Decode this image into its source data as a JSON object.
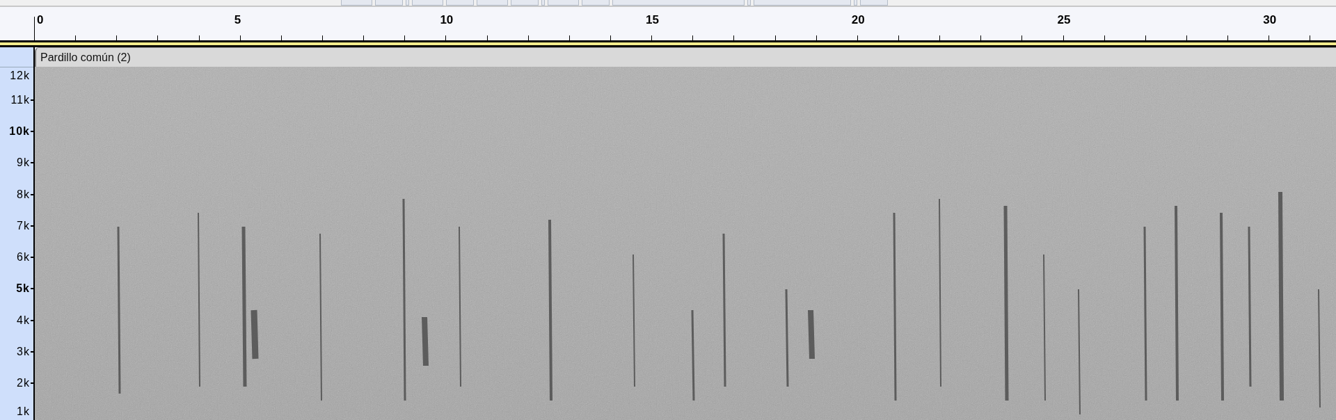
{
  "timeline": {
    "labels": [
      "0",
      "5",
      "10",
      "15",
      "20",
      "25",
      "30"
    ]
  },
  "track": {
    "label": "Pardillo común (2)"
  },
  "frequency_axis": {
    "labels": [
      {
        "text": "12k",
        "bold": false
      },
      {
        "text": "11k",
        "bold": false
      },
      {
        "text": "10k",
        "bold": true
      },
      {
        "text": "9k",
        "bold": false
      },
      {
        "text": "8k",
        "bold": false
      },
      {
        "text": "7k",
        "bold": false
      },
      {
        "text": "6k",
        "bold": false
      },
      {
        "text": "5k",
        "bold": true
      },
      {
        "text": "4k",
        "bold": false
      },
      {
        "text": "3k",
        "bold": false
      },
      {
        "text": "2k",
        "bold": false
      },
      {
        "text": "1k",
        "bold": false
      }
    ]
  }
}
